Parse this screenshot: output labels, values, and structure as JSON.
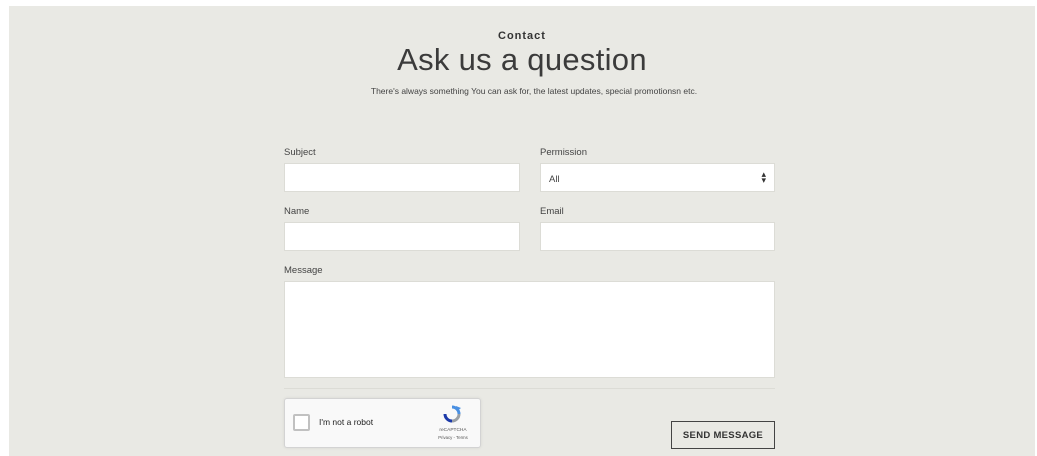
{
  "contact": {
    "eyebrow": "Contact",
    "title": "Ask us a question",
    "subtitle": "There's always something You can ask for, the latest updates, special promotionsn etc."
  },
  "form": {
    "subject_label": "Subject",
    "subject_value": "",
    "permission_label": "Permission",
    "permission_selected": "All",
    "name_label": "Name",
    "name_value": "",
    "email_label": "Email",
    "email_value": "",
    "message_label": "Message",
    "message_value": ""
  },
  "recaptcha": {
    "label": "I'm not a robot",
    "brand": "reCAPTCHA",
    "terms": "Privacy - Terms",
    "checked": false
  },
  "actions": {
    "send_label": "SEND MESSAGE"
  },
  "icons": {
    "select_arrow": "sort-updown-icon",
    "recaptcha_logo": "recaptcha-logo-icon"
  },
  "colors": {
    "background": "#e9e9e4",
    "input_bg": "#ffffff",
    "text": "#333333"
  }
}
